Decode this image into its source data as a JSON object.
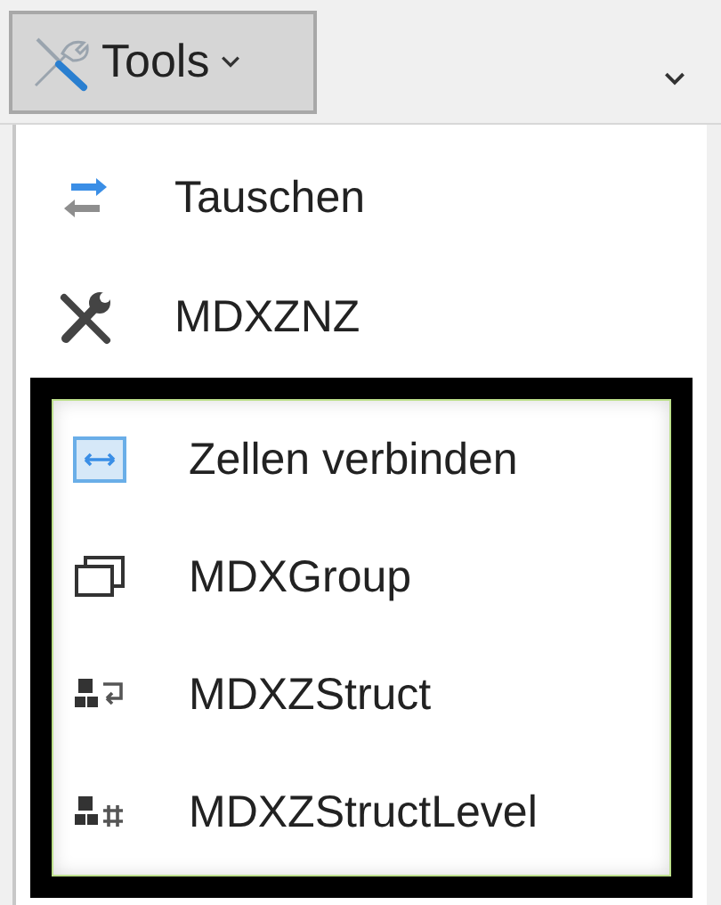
{
  "toolbar": {
    "tools_button": {
      "label": "Tools",
      "pressed": true
    }
  },
  "menu": {
    "items": [
      {
        "label": "Tauschen",
        "kind": "swap"
      },
      {
        "label": "MDXZNZ",
        "kind": "tools"
      }
    ],
    "highlighted_items": [
      {
        "label": "Zellen verbinden",
        "kind": "merge"
      },
      {
        "label": "MDXGroup",
        "kind": "group"
      },
      {
        "label": "MDXZStruct",
        "kind": "struct"
      },
      {
        "label": "MDXZStructLevel",
        "kind": "struct-level"
      }
    ]
  }
}
